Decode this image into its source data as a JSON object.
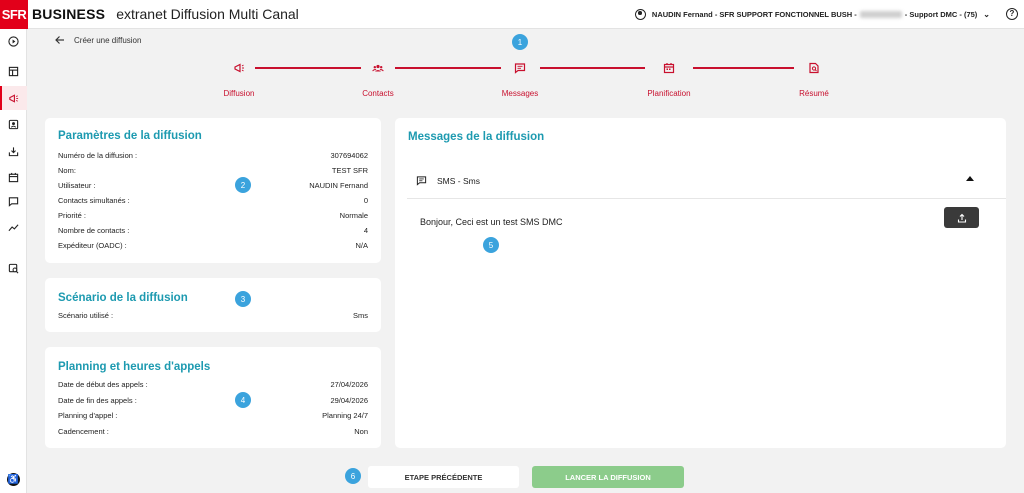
{
  "header": {
    "logo_text": "SFR",
    "brand": "BUSINESS",
    "app_title": "extranet Diffusion Multi Canal",
    "user_prefix": "NAUDIN Fernand - SFR SUPPORT FONCTIONNEL BUSH -",
    "user_suffix": "- Support DMC - (75)",
    "help_icon": "?"
  },
  "sidebar": {
    "items": [
      {
        "icon": "play-circle-icon"
      },
      {
        "icon": "dashboard-icon"
      },
      {
        "icon": "megaphone-icon",
        "active": true
      },
      {
        "icon": "contact-card-icon"
      },
      {
        "icon": "inbox-download-icon"
      },
      {
        "icon": "calendar-icon"
      },
      {
        "icon": "chat-icon"
      },
      {
        "icon": "trend-chart-icon"
      },
      {
        "icon": "settings-search-icon"
      }
    ],
    "accessibility_icon": "♿"
  },
  "nav": {
    "back_label": "Créer une diffusion"
  },
  "stepper": {
    "steps": [
      {
        "label": "Diffusion",
        "icon": "megaphone-icon"
      },
      {
        "label": "Contacts",
        "icon": "group-icon"
      },
      {
        "label": "Messages",
        "icon": "message-icon"
      },
      {
        "label": "Planification",
        "icon": "calendar-icon"
      },
      {
        "label": "Résumé",
        "icon": "document-search-icon"
      }
    ],
    "accent_color": "#c8102e"
  },
  "markers": [
    "1",
    "2",
    "3",
    "4",
    "5",
    "6"
  ],
  "params": {
    "title": "Paramètres de la diffusion",
    "rows": [
      {
        "label": "Numéro de la diffusion :",
        "value": "307694062"
      },
      {
        "label": "Nom:",
        "value": "TEST SFR"
      },
      {
        "label": "Utilisateur :",
        "value": "NAUDIN Fernand"
      },
      {
        "label": "Contacts simultanés :",
        "value": "0"
      },
      {
        "label": "Priorité :",
        "value": "Normale"
      },
      {
        "label": "Nombre de contacts :",
        "value": "4"
      },
      {
        "label": "Expéditeur (OADC) :",
        "value": "N/A"
      }
    ]
  },
  "scenario": {
    "title": "Scénario de la diffusion",
    "rows": [
      {
        "label": "Scénario utilisé :",
        "value": "Sms"
      }
    ]
  },
  "planning": {
    "title": "Planning et heures d'appels",
    "rows": [
      {
        "label": "Date de début des appels :",
        "value": "27/04/2026"
      },
      {
        "label": "Date de fin des appels :",
        "value": "29/04/2026"
      },
      {
        "label": "Planning d'appel :",
        "value": "Planning 24/7"
      },
      {
        "label": "Cadencement :",
        "value": "Non"
      }
    ]
  },
  "messages": {
    "title": "Messages de la diffusion",
    "channel_label": "SMS - Sms",
    "text": "Bonjour, Ceci est un test SMS DMC",
    "title_color": "#1d9ab0"
  },
  "actions": {
    "prev_label": "ETAPE PRÉCÉDENTE",
    "launch_label": "LANCER LA DIFFUSION",
    "launch_color": "#8ccc8b"
  }
}
